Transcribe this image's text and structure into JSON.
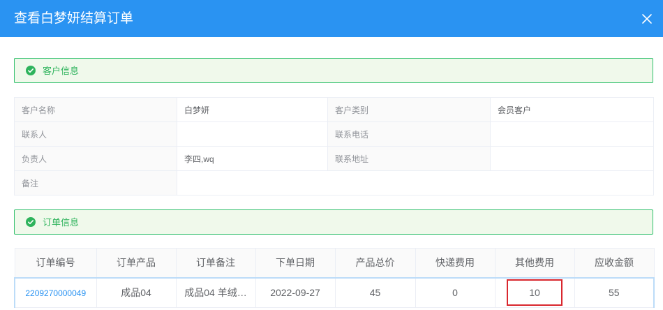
{
  "dialog": {
    "title": "查看白梦妍结算订单"
  },
  "customer_section": {
    "title": "客户信息"
  },
  "customer_info": {
    "name_label": "客户名称",
    "name_value": "白梦妍",
    "type_label": "客户类别",
    "type_value": "会员客户",
    "contact_label": "联系人",
    "contact_value": "",
    "phone_label": "联系电话",
    "phone_value": "",
    "owner_label": "负责人",
    "owner_value": "李四,wq",
    "address_label": "联系地址",
    "address_value": "",
    "remark_label": "备注",
    "remark_value": ""
  },
  "order_section": {
    "title": "订单信息"
  },
  "order_table": {
    "headers": [
      "订单编号",
      "订单产品",
      "订单备注",
      "下单日期",
      "产品总价",
      "快递费用",
      "其他费用",
      "应收金额"
    ],
    "rows": [
      {
        "order_no": "2209270000049",
        "product": "成品04",
        "remark": "成品04 羊绒…",
        "date": "2022-09-27",
        "total": "45",
        "shipping": "0",
        "other_fee": "10",
        "receivable": "55"
      }
    ]
  },
  "colors": {
    "header_bg": "#2a93f2",
    "success": "#2eb35c",
    "highlight": "#d9272e"
  }
}
